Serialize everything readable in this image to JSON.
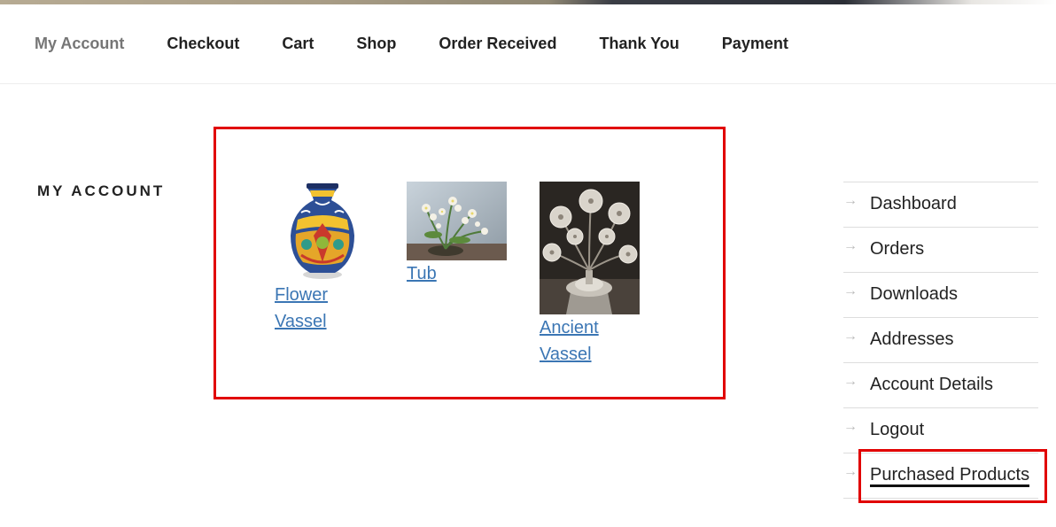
{
  "nav": {
    "items": [
      "My Account",
      "Checkout",
      "Cart",
      "Shop",
      "Order Received",
      "Thank You",
      "Payment"
    ]
  },
  "page": {
    "title": "MY ACCOUNT"
  },
  "products": [
    {
      "name": "Flower Vassel",
      "line1": "Flower",
      "line2": "Vassel",
      "image": "ceramic-vase-image"
    },
    {
      "name": "Tub",
      "line1": "Tub",
      "line2": "",
      "image": "flower-arrangement-image"
    },
    {
      "name": "Ancient Vassel",
      "line1": "Ancient",
      "line2": "Vassel",
      "image": "metal-flower-vase-image"
    }
  ],
  "account_nav": {
    "items": [
      "Dashboard",
      "Orders",
      "Downloads",
      "Addresses",
      "Account Details",
      "Logout",
      "Purchased Products"
    ],
    "active": "Purchased Products",
    "arrow": "→"
  },
  "colors": {
    "highlight": "#e10000",
    "link": "#3b76b4",
    "nav_current": "#767676"
  }
}
